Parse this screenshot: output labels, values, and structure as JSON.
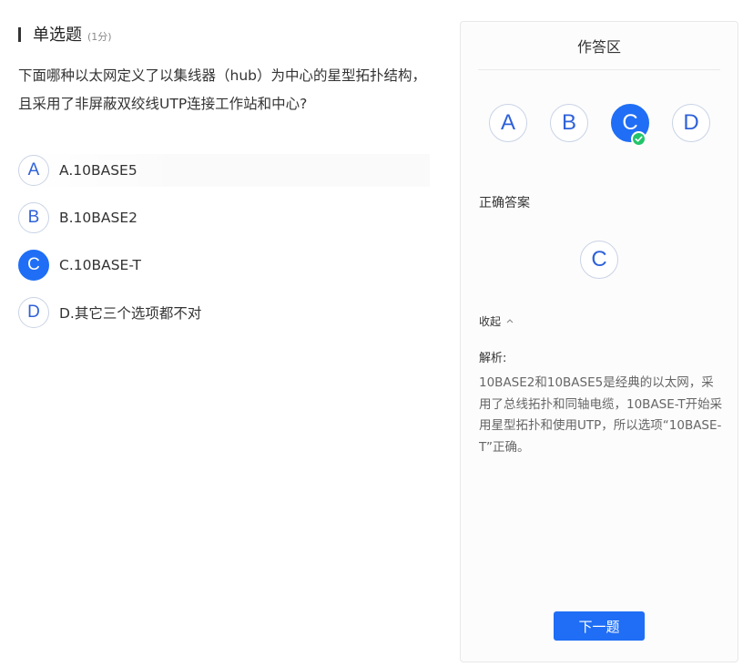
{
  "question": {
    "type_label": "单选题",
    "score_label": "(1分)",
    "text": "下面哪种以太网定义了以集线器（hub）为中心的星型拓扑结构，且采用了非屏蔽双绞线UTP连接工作站和中心?",
    "options": [
      {
        "letter": "A",
        "label": "A.10BASE5"
      },
      {
        "letter": "B",
        "label": "B.10BASE2"
      },
      {
        "letter": "C",
        "label": "C.10BASE-T",
        "selected": true
      },
      {
        "letter": "D",
        "label": "D.其它三个选项都不对"
      }
    ]
  },
  "panel": {
    "title": "作答区",
    "choices": [
      "A",
      "B",
      "C",
      "D"
    ],
    "selected_choice": "C",
    "correct_title": "正确答案",
    "correct_answer": "C",
    "collapse_label": "收起",
    "explanation_title": "解析:",
    "explanation_text": "10BASE2和10BASE5是经典的以太网，采用了总线拓扑和同轴电缆，10BASE-T开始采用星型拓扑和使用UTP，所以选项“10BASE-T”正确。",
    "next_label": "下一题"
  },
  "colors": {
    "accent": "#1f6ef5",
    "success": "#22c46a",
    "option_text": "#2f62d9"
  },
  "icons": {
    "check": "check-icon",
    "collapse": "chevron-up-icon"
  }
}
